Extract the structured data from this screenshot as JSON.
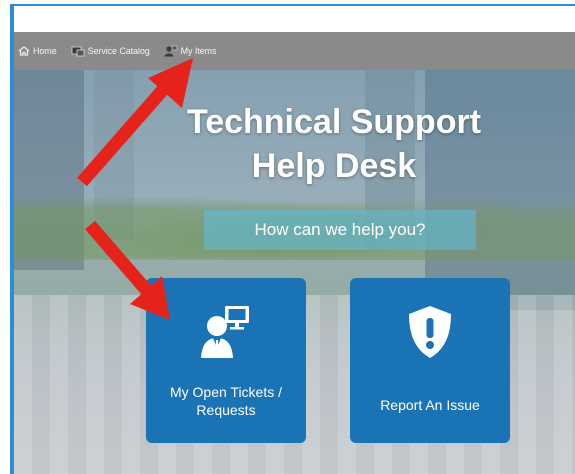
{
  "nav": {
    "items": [
      {
        "label": "Home",
        "icon": "home-icon"
      },
      {
        "label": "Service Catalog",
        "icon": "catalog-icon"
      },
      {
        "label": "My Items",
        "icon": "user-items-icon"
      }
    ]
  },
  "hero": {
    "title_line1": "Technical Support",
    "title_line2": "Help Desk",
    "help_text": "How can we help you?"
  },
  "tiles": [
    {
      "label_line1": "My Open Tickets /",
      "label_line2": "Requests",
      "icon": "support-agent-icon"
    },
    {
      "label": "Report An Issue",
      "icon": "shield-exclamation-icon"
    }
  ],
  "colors": {
    "tile": "#1973b5",
    "nav": "#8a8a8a",
    "frame_border": "#2e8bd6",
    "annotation_arrow": "#e5231b"
  }
}
